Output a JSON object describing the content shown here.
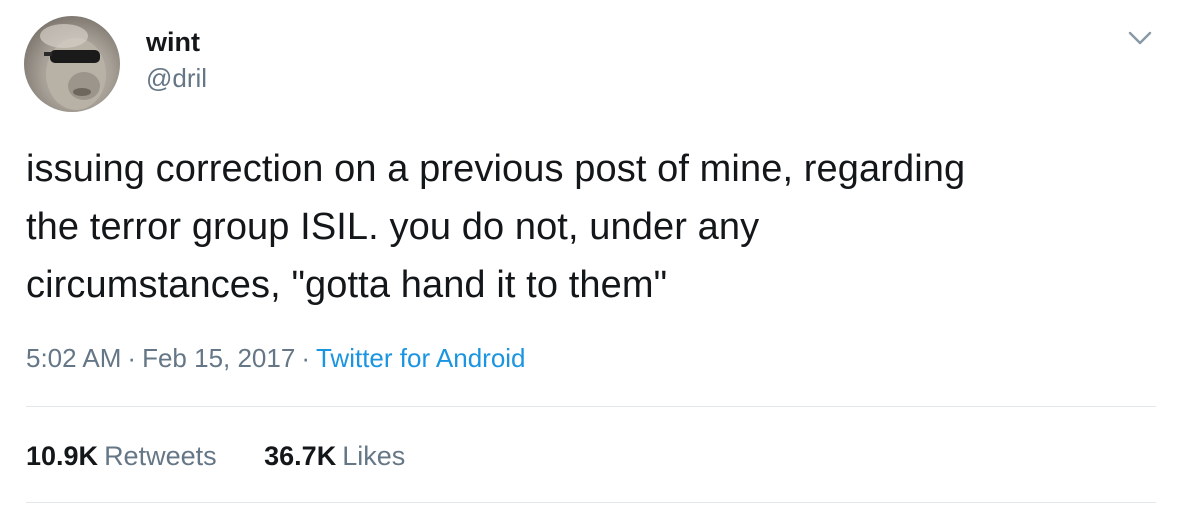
{
  "user": {
    "display_name": "wint",
    "handle": "@dril"
  },
  "tweet": {
    "lines": [
      "issuing correction on a previous post of mine, regarding",
      "the terror group ISIL. you do not, under any",
      "circumstances, \"gotta hand it to them\""
    ],
    "time": "5:02 AM",
    "date": "Feb 15, 2017",
    "separator": "·",
    "source": "Twitter for Android"
  },
  "stats": {
    "retweets_count": "10.9K",
    "retweets_label": "Retweets",
    "likes_count": "36.7K",
    "likes_label": "Likes"
  },
  "icons": {
    "menu": "chevron-down-icon"
  },
  "colors": {
    "text": "#14171a",
    "secondary": "#657786",
    "link": "#1b95e0",
    "divider": "#e1e8ed"
  }
}
